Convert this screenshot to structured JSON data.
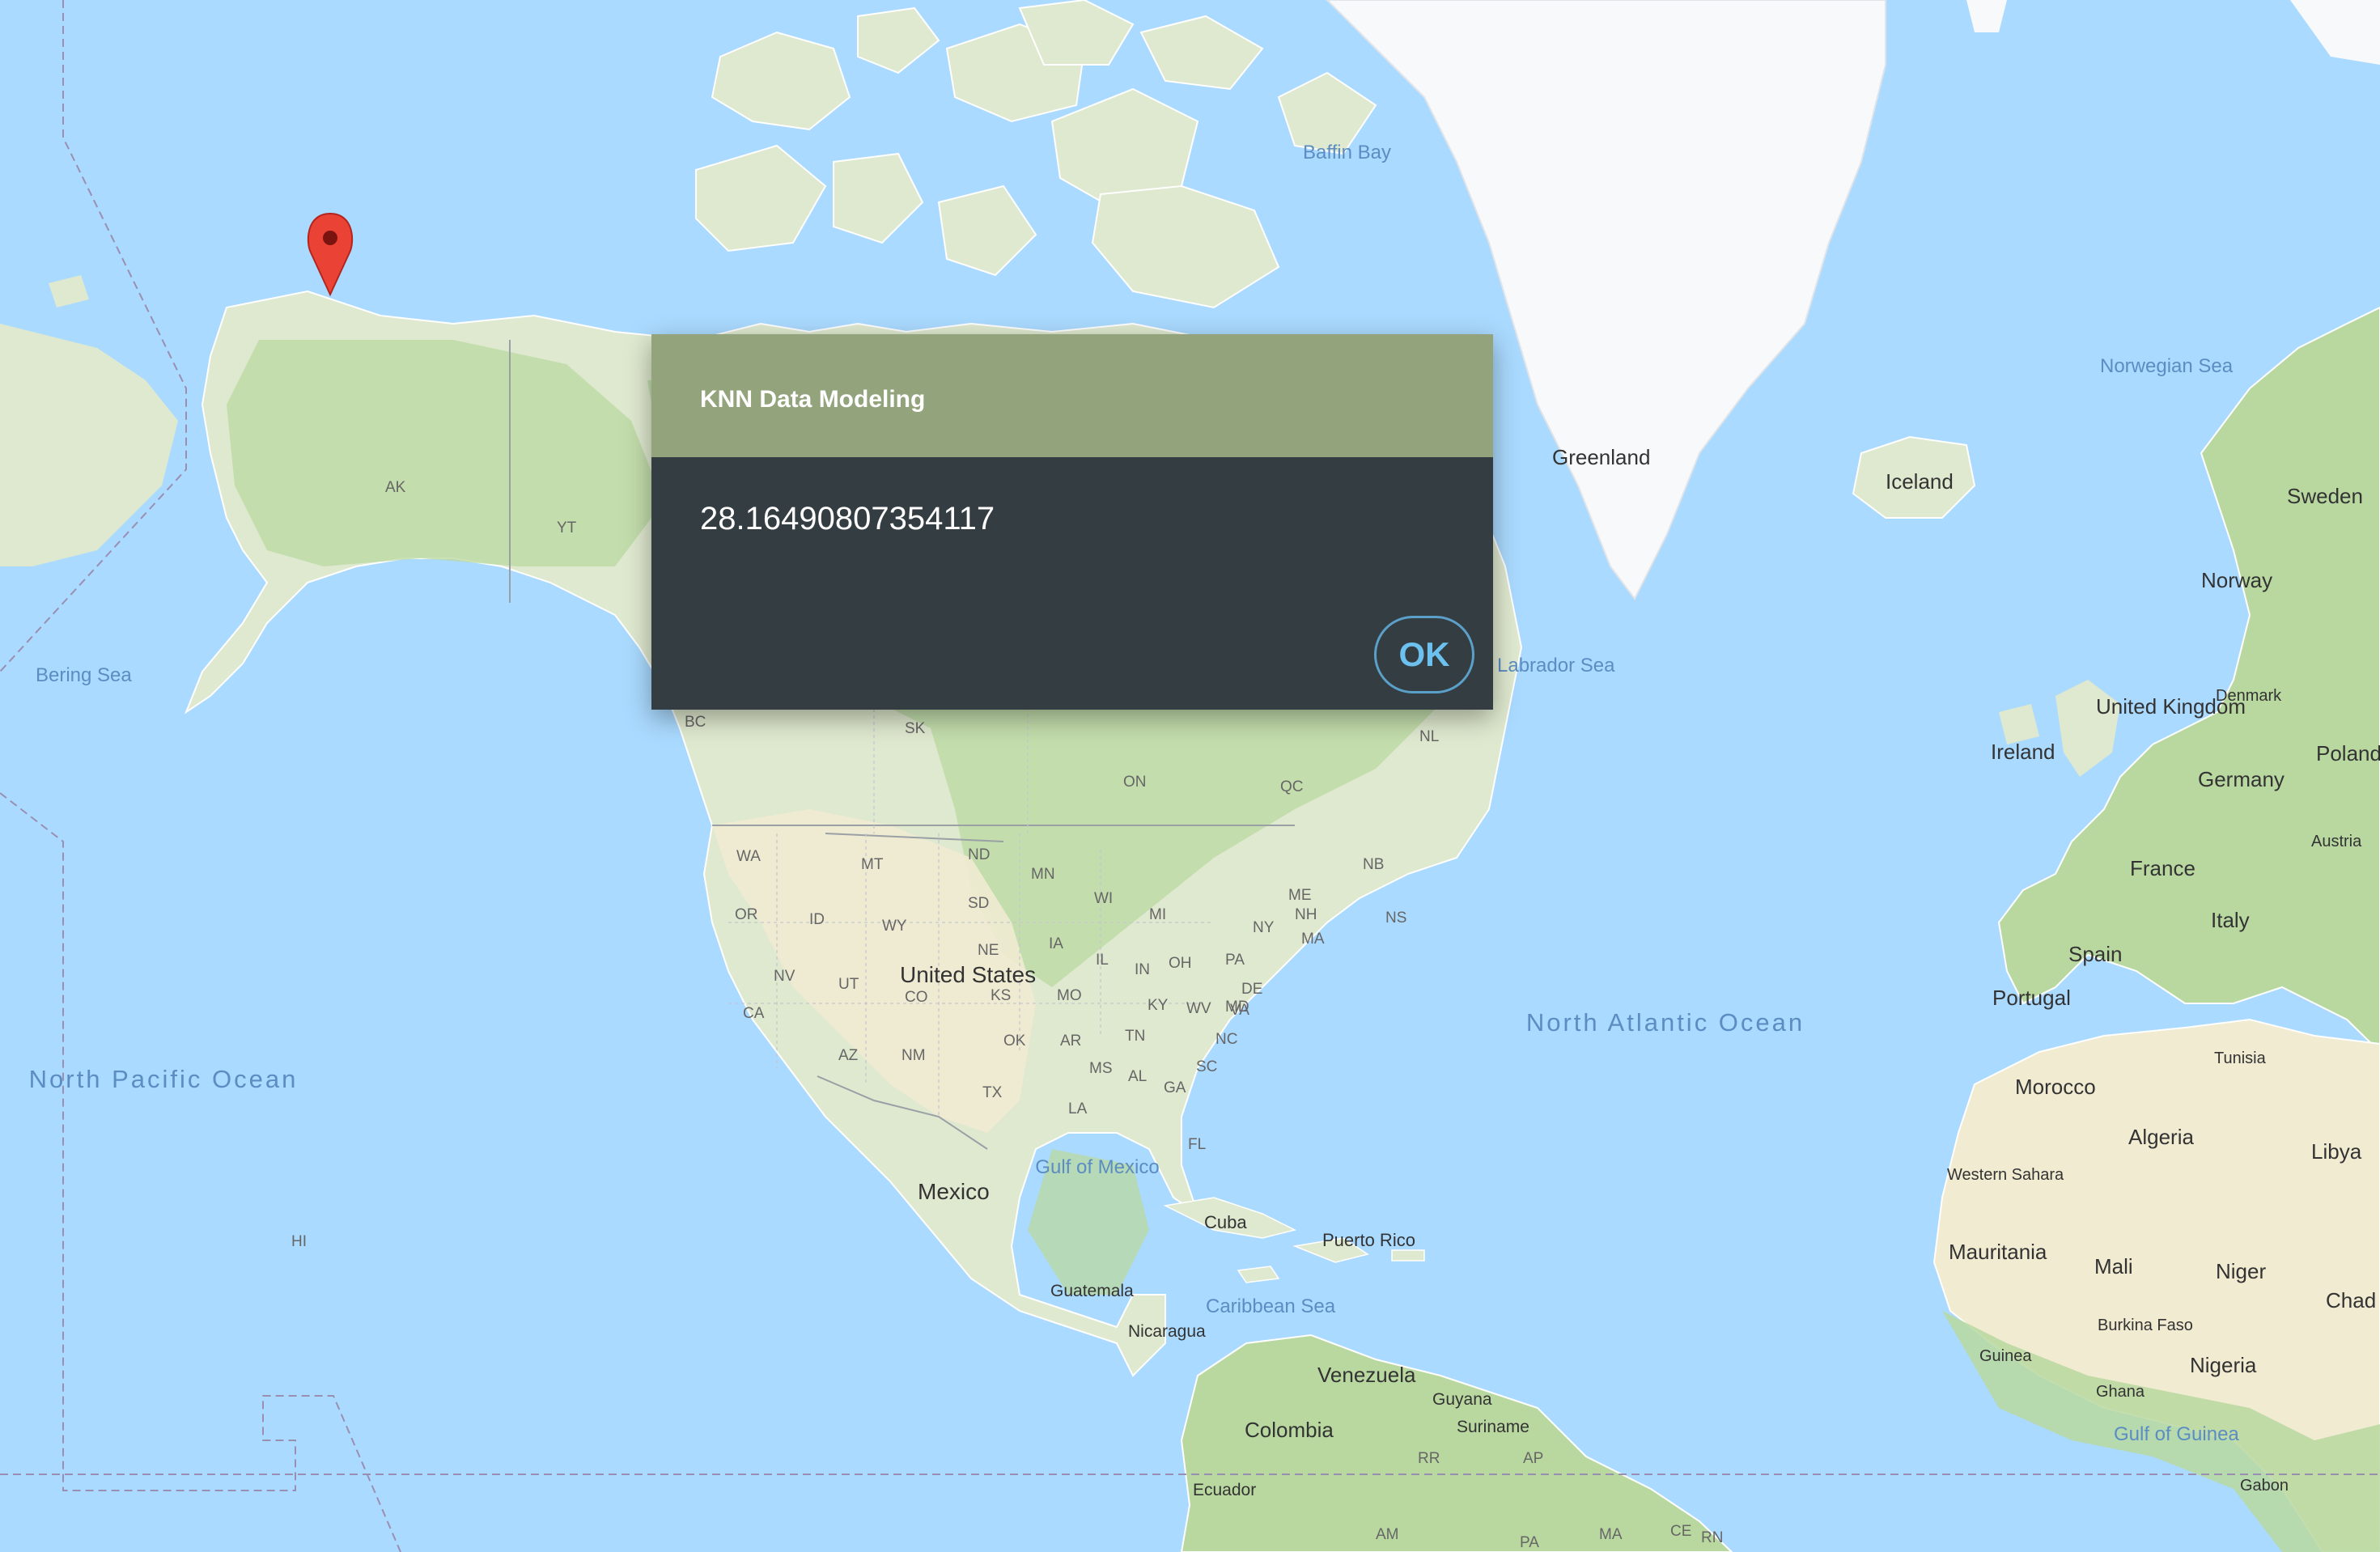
{
  "dialog": {
    "title": "KNN Data Modeling",
    "message": "28.16490807354117",
    "ok_label": "OK"
  },
  "map": {
    "colors": {
      "water": "#aadaff",
      "land": "#dfe9cf",
      "green": "#b9d8a0",
      "desert": "#f1ebd2",
      "ice": "#f8f9fa",
      "border": "#9aa0a6",
      "water_label": "#5b8dc2",
      "land_label": "#333333",
      "pin": "#ea4335"
    },
    "labels": {
      "oceans": [
        "Baffin Bay",
        "Norwegian Sea",
        "Bering Sea",
        "Labrador Sea",
        "North Pacific Ocean",
        "North Atlantic Ocean",
        "Gulf of Mexico",
        "Caribbean Sea",
        "Gulf of Guinea"
      ],
      "countries": [
        "Greenland",
        "Iceland",
        "Sweden",
        "Norway",
        "Denmark",
        "United Kingdom",
        "Ireland",
        "Germany",
        "Poland",
        "Austria",
        "France",
        "Italy",
        "Spain",
        "Portugal",
        "Tunisia",
        "Morocco",
        "Algeria",
        "Libya",
        "Western Sahara",
        "Mauritania",
        "Mali",
        "Niger",
        "Chad",
        "Burkina Faso",
        "Guinea",
        "Ghana",
        "Nigeria",
        "Gabon",
        "United States",
        "Mexico",
        "Cuba",
        "Puerto Rico",
        "Guatemala",
        "Nicaragua",
        "Venezuela",
        "Guyana",
        "Suriname",
        "Colombia",
        "Ecuador"
      ],
      "regions": [
        "AK",
        "YT",
        "BC",
        "SK",
        "ON",
        "QC",
        "NL",
        "NB",
        "NS",
        "WA",
        "MT",
        "ND",
        "MN",
        "OR",
        "ID",
        "SD",
        "WY",
        "WI",
        "MI",
        "NE",
        "IA",
        "IL",
        "IN",
        "OH",
        "PA",
        "NY",
        "ME",
        "NH",
        "MA",
        "NV",
        "UT",
        "CO",
        "KS",
        "MO",
        "KY",
        "WV",
        "MD",
        "DE",
        "VA",
        "CA",
        "AZ",
        "NM",
        "OK",
        "AR",
        "TN",
        "NC",
        "SC",
        "MS",
        "AL",
        "GA",
        "TX",
        "LA",
        "FL",
        "HI",
        "RR",
        "AP",
        "AM",
        "PA",
        "MA",
        "CE",
        "RN"
      ]
    }
  }
}
